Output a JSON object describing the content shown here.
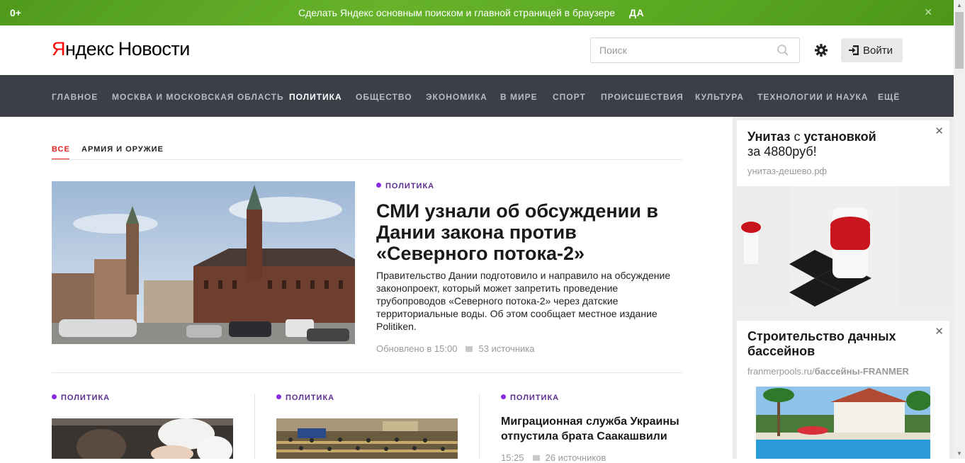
{
  "promo": {
    "age": "0+",
    "message": "Сделать Яндекс основным поиском и главной страницей в браузере",
    "accept": "ДА",
    "close": "×"
  },
  "header": {
    "logo_yandex_y": "Я",
    "logo_yandex_rest": "ндекс",
    "logo_service": "Новости",
    "search_placeholder": "Поиск",
    "login_label": "Войти"
  },
  "nav": {
    "items": [
      "ГЛАВНОЕ",
      "МОСКВА И МОСКОВСКАЯ ОБЛАСТЬ",
      "ПОЛИТИКА",
      "ОБЩЕСТВО",
      "ЭКОНОМИКА",
      "В МИРЕ",
      "СПОРТ",
      "ПРОИСШЕСТВИЯ",
      "КУЛЬТУРА",
      "ТЕХНОЛОГИИ И НАУКА",
      "ЕЩЁ"
    ],
    "active": "ПОЛИТИКА"
  },
  "subtabs": [
    "ВСЕ",
    "АРМИЯ И ОРУЖИЕ"
  ],
  "main_story": {
    "rubric": "ПОЛИТИКА",
    "title": "СМИ узнали об обсуждении в Дании закона против «Северного потока-2»",
    "annotation": "Правительство Дании подготовило и направило на обсуждение законопроект, который может запретить проведение трубопроводов «Северного потока-2» через датские территориальные воды. Об этом сообщает местное издание Politiken.",
    "updated": "Обновлено в 15:00",
    "sources": "53 источника"
  },
  "cards": [
    {
      "rubric": "ПОЛИТИКА"
    },
    {
      "rubric": "ПОЛИТИКА"
    },
    {
      "rubric": "ПОЛИТИКА",
      "title": "Миграционная служба Украины отпустила брата Саакашвили",
      "time": "15:25",
      "sources": "26 источников"
    }
  ],
  "ads": [
    {
      "title_bold_1": "Унитаз",
      "title_normal": " с ",
      "title_bold_2": "установкой",
      "title_line2": "за 4880руб!",
      "domain": "унитаз-дешево.рф"
    },
    {
      "title": "Строительство дачных бассейнов",
      "domain_plain": "franmerpools.ru/",
      "domain_bold": "бассейны-FRANMER"
    }
  ],
  "icons": [
    "search-icon",
    "gear-icon",
    "login-icon",
    "close-icon"
  ],
  "colors": {
    "promo_green": "#5aa822",
    "nav_bg": "#3c3f48",
    "accent_red": "#e02020",
    "rubric_purple": "#8a2be2"
  }
}
